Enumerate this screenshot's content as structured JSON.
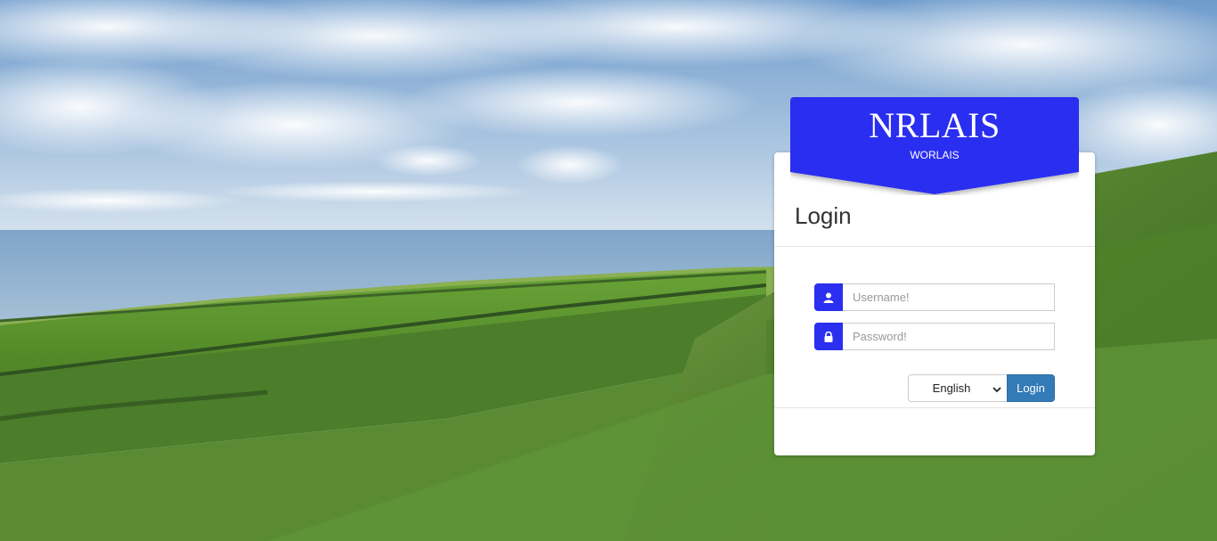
{
  "banner": {
    "title": "NRLAIS",
    "subtitle": "WORLAIS",
    "color": "#2b2ff0"
  },
  "login_panel": {
    "title": "Login",
    "username": {
      "placeholder": "Username!",
      "icon": "user-icon"
    },
    "password": {
      "placeholder": "Password!",
      "icon": "lock-icon"
    },
    "language": {
      "selected": "English"
    },
    "submit_label": "Login",
    "button_color": "#337ab7"
  },
  "background": {
    "description_colors": {
      "sky": "#7fa8d4",
      "sea": "#8fb2d2",
      "grass": "#5f8f3a"
    }
  }
}
